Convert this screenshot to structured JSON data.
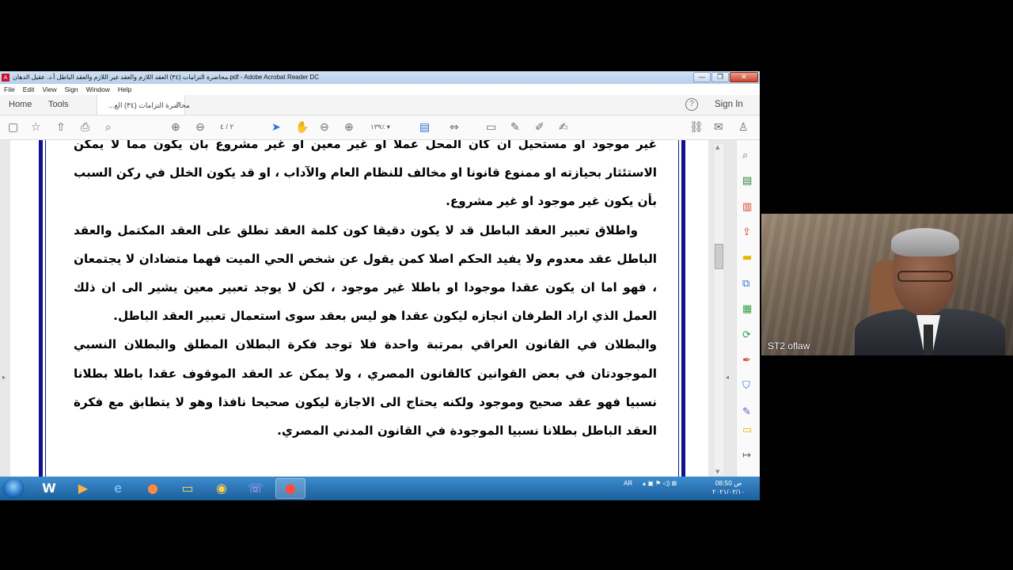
{
  "window": {
    "title": "محاضرة التزامات (٣٤) العقد اللازم والعقد غير اللازم والعقد الباطل أ.د. عقيل الدهان.pdf - Adobe Acrobat Reader DC",
    "buttons": {
      "minimize": "—",
      "maximize": "❐",
      "close": "✕"
    }
  },
  "menu": [
    "File",
    "Edit",
    "View",
    "Sign",
    "Window",
    "Help"
  ],
  "tabs": {
    "home": "Home",
    "tools": "Tools",
    "document": "محاضرة التزامات (٣٤) الع...",
    "close": "×"
  },
  "header": {
    "help": "?",
    "sign_in": "Sign In"
  },
  "toolbar": {
    "page_current": "٢",
    "page_total": "/ ٤",
    "zoom": "١٣٩٪"
  },
  "document": {
    "paragraphs": [
      "غير موجود او مستحيل ان كان المحل عملا او غير معين او غير مشروع بان يكون مما لا يمكن الاستئثار بحيازته او ممنوع قانونا او مخالف للنظام العام والآداب ، او قد يكون الخلل في ركن السبب بأن يكون غير موجود او غير مشروع.",
      "واطلاق تعبير العقد الباطل قد لا يكون دقيقا كون كلمة العقد تطلق على العقد المكتمل والعقد الباطل عقد معدوم ولا يفيد الحكم اصلا كمن يقول عن شخص الحي الميت فهما متضادان لا يجتمعان ، فهو اما ان يكون عقدا موجودا او باطلا غير موجود ، لكن لا يوجد تعبير معين يشير الى ان ذلك العمل الذي اراد الطرفان انجازه ليكون عقدا هو ليس بعقد سوى استعمال تعبير العقد الباطل.",
      "والبطلان في القانون العراقي بمرتبة واحدة فلا توجد فكرة البطلان المطلق والبطلان النسبي الموجودتان في بعض القوانين كالقانون المصري ، ولا يمكن عد العقد الموقوف عقدا باطلا بطلانا نسبيا فهو عقد صحيح وموجود ولكنه يحتاج الى الاجازة ليكون صحيحا نافذا وهو لا يتطابق مع فكرة العقد الباطل بطلانا نسبيا الموجودة في القانون المدني المصري."
    ]
  },
  "taskbar": {
    "apps": [
      "Word",
      "Media Player",
      "Internet Explorer",
      "Firefox",
      "File Explorer",
      "Chrome",
      "Viber",
      "Adobe Acrobat"
    ],
    "language": "AR",
    "time": "08:50 ص",
    "date": "٢٠٢١/٠٢/١٠"
  },
  "webcam": {
    "participant": "ST2 oflaw"
  }
}
